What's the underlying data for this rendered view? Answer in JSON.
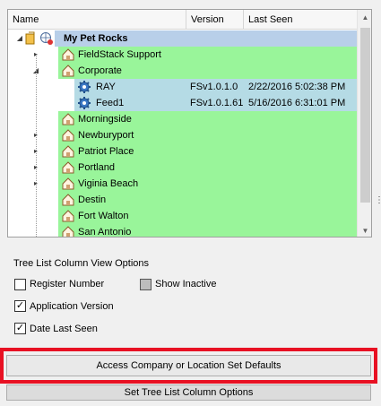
{
  "tree": {
    "columns": {
      "name": "Name",
      "version": "Version",
      "last_seen": "Last Seen"
    },
    "root": {
      "label": "My Pet Rocks"
    },
    "rows": [
      {
        "label": "FieldStack Support",
        "expander": "▸",
        "type": "location"
      },
      {
        "label": "Corporate",
        "expander": "◢",
        "type": "location"
      },
      {
        "label": "RAY",
        "version": "FSv1.0.1.0",
        "last_seen": "2/22/2016 5:02:38 PM",
        "type": "device"
      },
      {
        "label": "Feed1",
        "version": "FSv1.0.1.61",
        "last_seen": "5/16/2016 6:31:01 PM",
        "type": "device"
      },
      {
        "label": "Morningside",
        "expander": "",
        "type": "location"
      },
      {
        "label": "Newburyport",
        "expander": "▸",
        "type": "location"
      },
      {
        "label": "Patriot Place",
        "expander": "▸",
        "type": "location"
      },
      {
        "label": "Portland",
        "expander": "▸",
        "type": "location"
      },
      {
        "label": "Viginia Beach",
        "expander": "▸",
        "type": "location"
      },
      {
        "label": "Destin",
        "expander": "",
        "type": "location"
      },
      {
        "label": "Fort Walton",
        "expander": "",
        "type": "location"
      },
      {
        "label": "San Antonio",
        "expander": "",
        "type": "location"
      }
    ]
  },
  "options": {
    "title": "Tree List Column View Options",
    "register_number": {
      "label": "Register Number",
      "checked": false
    },
    "show_inactive": {
      "label": "Show Inactive",
      "checked": false
    },
    "application_version": {
      "label": "Application Version",
      "checked": true
    },
    "date_last_seen": {
      "label": "Date Last Seen",
      "checked": true
    }
  },
  "buttons": {
    "access_defaults": "Access Company or Location Set Defaults",
    "set_columns": "Set Tree List Column Options"
  },
  "colors": {
    "location_row": "#99f59a",
    "device_row": "#b5dbe5",
    "highlight": "#e81123"
  }
}
